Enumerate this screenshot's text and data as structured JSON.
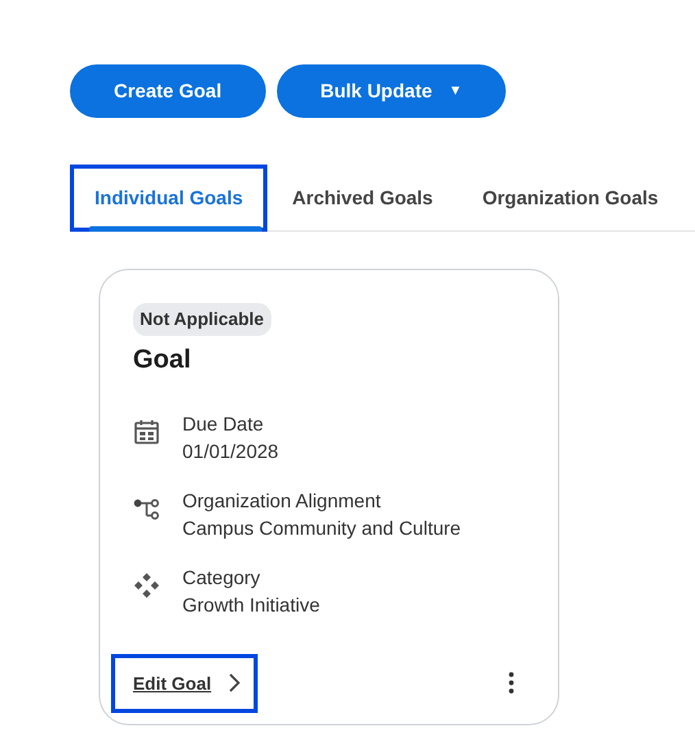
{
  "actions": [
    {
      "label": "Create Goal",
      "kind": "plain"
    },
    {
      "label": "Bulk Update",
      "kind": "dropdown",
      "caret": "▼"
    }
  ],
  "tabs": [
    {
      "label": "Individual Goals",
      "selected": true,
      "highlighted": true
    },
    {
      "label": "Archived Goals",
      "selected": false,
      "highlighted": false
    },
    {
      "label": "Organization Goals",
      "selected": false,
      "highlighted": false
    }
  ],
  "goal_card": {
    "status": "Not Applicable",
    "title": "Goal",
    "fields": [
      {
        "kind": "calendar",
        "label": "Due Date",
        "value": "01/01/2028"
      },
      {
        "kind": "hierarchy",
        "label": "Organization Alignment",
        "value": "Campus Community and Culture"
      },
      {
        "kind": "category",
        "label": "Category",
        "value": "Growth Initiative"
      }
    ],
    "edit_link": {
      "label": "Edit Goal",
      "highlighted": true
    }
  }
}
